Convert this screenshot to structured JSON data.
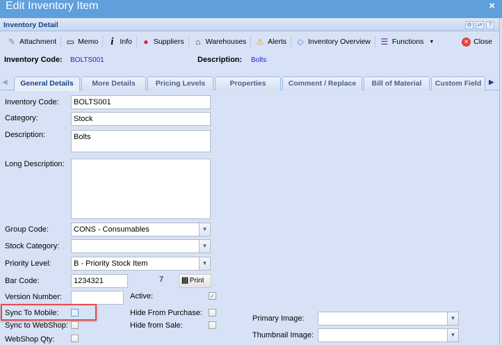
{
  "window": {
    "title": "Edit Inventory Item",
    "close_icon": "×"
  },
  "panel": {
    "title": "Inventory Detail"
  },
  "toolbar": {
    "items": [
      {
        "label": "Attachment",
        "icon": "paperclip-icon",
        "glyph": "📎"
      },
      {
        "label": "Memo",
        "icon": "memo-icon",
        "glyph": "▭"
      },
      {
        "label": "Info",
        "icon": "info-icon",
        "glyph": "i"
      },
      {
        "label": "Suppliers",
        "icon": "suppliers-icon",
        "glyph": "●"
      },
      {
        "label": "Warehouses",
        "icon": "warehouse-icon",
        "glyph": "⌂"
      },
      {
        "label": "Alerts",
        "icon": "alert-icon",
        "glyph": "⚠"
      },
      {
        "label": "Inventory Overview",
        "icon": "tag-icon",
        "glyph": "◇"
      },
      {
        "label": "Functions",
        "icon": "menu-icon",
        "glyph": "☰"
      }
    ],
    "close_label": "Close"
  },
  "header": {
    "code_label": "Inventory Code:",
    "code_value": "BOLTS001",
    "desc_label": "Description:",
    "desc_value": "Bolts"
  },
  "tabs": [
    "General Details",
    "More Details",
    "Pricing Levels",
    "Properties",
    "Comment / Replace",
    "Bill of Material",
    "Custom Field"
  ],
  "form": {
    "inventory_code": {
      "label": "Inventory Code:",
      "value": "BOLTS001"
    },
    "category": {
      "label": "Category:",
      "value": "Stock"
    },
    "description": {
      "label": "Description:",
      "value": "Bolts"
    },
    "long_description": {
      "label": "Long Description:",
      "value": ""
    },
    "group_code": {
      "label": "Group Code:",
      "value": "CONS - Consumables"
    },
    "stock_category": {
      "label": "Stock Category:",
      "value": ""
    },
    "priority_level": {
      "label": "Priority Level:",
      "value": "B - Priority Stock Item"
    },
    "bar_code": {
      "label": "Bar Code:",
      "value": "1234321",
      "check_digit": "7",
      "print_label": "Print"
    },
    "version_number": {
      "label": "Version Number:",
      "value": ""
    },
    "active": {
      "label": "Active:",
      "checked": true
    },
    "sync_to_mobile": {
      "label": "Sync To Mobile:",
      "checked": false
    },
    "hide_from_purchase": {
      "label": "Hide From Purchase:",
      "checked": false
    },
    "sync_to_webshop": {
      "label": "Sync to WebShop:",
      "checked": false
    },
    "hide_from_sale": {
      "label": "Hide from Sale:",
      "checked": false
    },
    "webshop_qty": {
      "label": "WebShop Qty:",
      "checked": false
    },
    "primary_image": {
      "label": "Primary Image:",
      "value": ""
    },
    "thumbnail_image": {
      "label": "Thumbnail Image:",
      "value": ""
    }
  },
  "colors": {
    "titlebar": "#5e9fdc",
    "highlight": "#e84a4a",
    "link": "#1a1ae6"
  }
}
